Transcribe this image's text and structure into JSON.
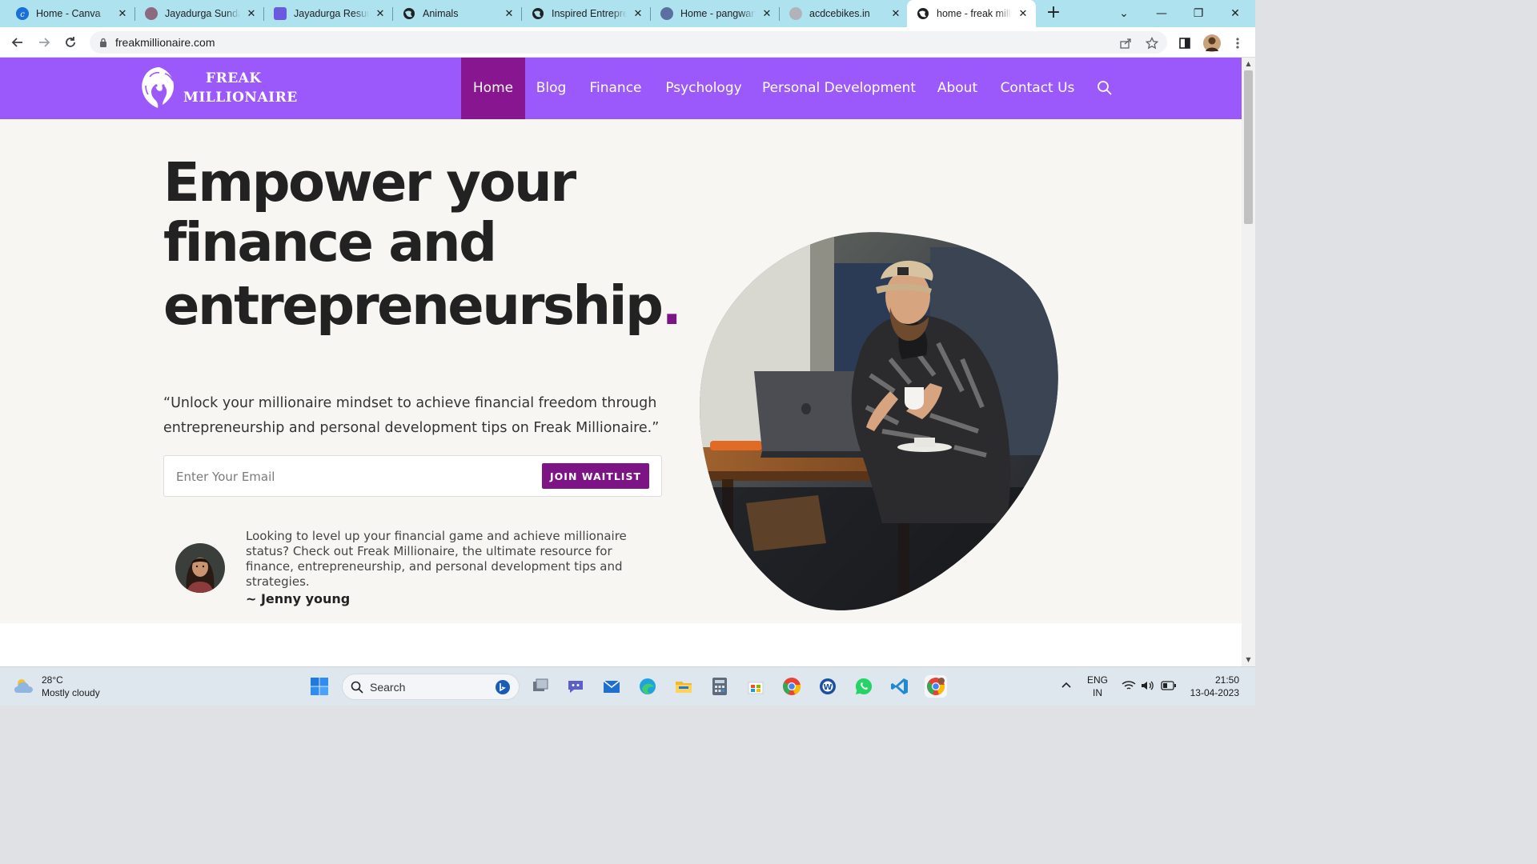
{
  "browser": {
    "tabs": [
      {
        "title": "Home - Canva",
        "icon": "canva-icon",
        "color": "#00c4cc"
      },
      {
        "title": "Jayadurga Sundar",
        "icon": "profile-icon",
        "color": "#8c6b82"
      },
      {
        "title": "Jayadurga Resum",
        "icon": "docs-icon",
        "color": "#6a5ae0"
      },
      {
        "title": "Animals",
        "icon": "globe-icon",
        "color": "#202124"
      },
      {
        "title": "Inspired Entrepre",
        "icon": "globe-icon",
        "color": "#202124"
      },
      {
        "title": "Home - pangwan",
        "icon": "wordpress-icon",
        "color": "#5b6fa0"
      },
      {
        "title": "acdcebikes.in",
        "icon": "loading-icon",
        "color": "#b0b4ba"
      },
      {
        "title": "home - freak milli",
        "icon": "globe-icon",
        "color": "#202124"
      }
    ],
    "new_tab": "+",
    "url": "freakmillionaire.com"
  },
  "site": {
    "logo_line1": "FREAK",
    "logo_line2": "MILLIONAIRE",
    "nav": [
      "Home",
      "Blog",
      "Finance",
      "Psychology",
      "Personal Development",
      "About",
      "Contact Us"
    ],
    "active_nav": "Home",
    "colors": {
      "nav_bg": "#9b59fb",
      "accent": "#7d1486",
      "hero_bg": "#f7f6f3"
    }
  },
  "hero": {
    "headline_line1": "Empower your",
    "headline_line2": "finance and",
    "headline_line3": "entrepreneurship",
    "headline_dot": ".",
    "quote": "“Unlock your millionaire mindset to achieve financial freedom through entrepreneurship and personal development tips on Freak Millionaire.”",
    "email_placeholder": "Enter Your Email",
    "cta": "JOIN WAITLIST",
    "testimonial": "Looking to level up your financial game and achieve millionaire status? Check out Freak Millionaire, the ultimate resource for finance, entrepreneurship, and personal development tips and strategies.",
    "author": "~ Jenny young"
  },
  "taskbar": {
    "temperature": "28°C",
    "weather": "Mostly cloudy",
    "search": "Search",
    "lang1": "ENG",
    "lang2": "IN",
    "time": "21:50",
    "date": "13-04-2023"
  }
}
